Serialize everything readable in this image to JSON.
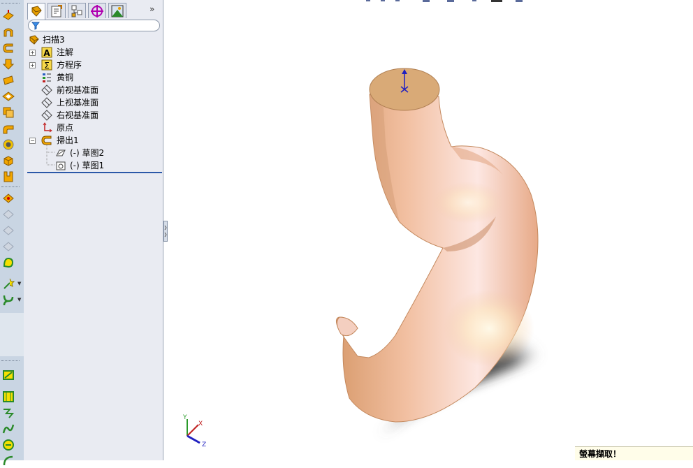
{
  "tree": {
    "root": "扫描3",
    "items": [
      {
        "label": "注解",
        "icon": "annotation-icon",
        "expand": "+"
      },
      {
        "label": "方程序",
        "icon": "equation-icon",
        "expand": "+"
      },
      {
        "label": "黄铜",
        "icon": "material-icon"
      },
      {
        "label": "前视基准面",
        "icon": "plane-icon"
      },
      {
        "label": "上视基准面",
        "icon": "plane-icon"
      },
      {
        "label": "右视基准面",
        "icon": "plane-icon"
      },
      {
        "label": "原点",
        "icon": "origin-icon"
      },
      {
        "label": "掃出1",
        "icon": "sweep-icon",
        "expand": "−"
      }
    ],
    "children": [
      {
        "label": "(-) 草图2",
        "icon": "sketch-icon"
      },
      {
        "label": "(-) 草图1",
        "icon": "sketch-icon"
      }
    ]
  },
  "panel": {
    "expand_label": "»"
  },
  "triad": {
    "x": "X",
    "y": "Y",
    "z": "Z"
  },
  "status": {
    "text": "螢幕擷取！"
  },
  "colors": {
    "model": "#efc2a8",
    "cap": "#d9aa77",
    "panel": "#e9ebf2",
    "toolbar": "#c9d5e3"
  }
}
